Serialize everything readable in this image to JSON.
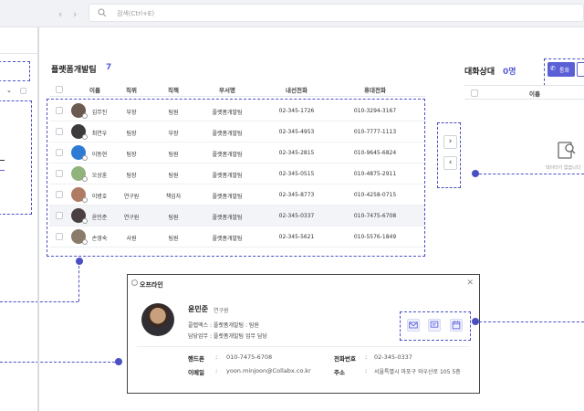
{
  "search": {
    "placeholder": "검색(Ctrl+E)"
  },
  "team": {
    "title": "플랫폼개발팀",
    "count": "7",
    "columns": [
      "이름",
      "직위",
      "직책",
      "부서명",
      "내선전화",
      "휴대전화"
    ],
    "rows": [
      {
        "name": "김무진",
        "rank": "부장",
        "role": "팀원",
        "dept": "플랫폼개발팀",
        "ext": "02-345-1726",
        "mobile": "010-3294-3167",
        "color": "#6b5a4f"
      },
      {
        "name": "최연우",
        "rank": "팀장",
        "role": "부장",
        "dept": "플랫폼개발팀",
        "ext": "02-345-4953",
        "mobile": "010-7777-1113",
        "color": "#3d3a3c"
      },
      {
        "name": "이동현",
        "rank": "팀장",
        "role": "팀원",
        "dept": "플랫폼개발팀",
        "ext": "02-345-2815",
        "mobile": "010-9645-6824",
        "color": "#2e7bd6"
      },
      {
        "name": "오상훈",
        "rank": "팀장",
        "role": "팀원",
        "dept": "플랫폼개발팀",
        "ext": "02-345-0515",
        "mobile": "010-4875-2911",
        "color": "#8fb37a"
      },
      {
        "name": "이병호",
        "rank": "연구원",
        "role": "책임자",
        "dept": "플랫폼개발팀",
        "ext": "02-345-8773",
        "mobile": "010-4258-0715",
        "color": "#b07a63"
      },
      {
        "name": "윤민준",
        "rank": "연구원",
        "role": "팀원",
        "dept": "플랫폼개발팀",
        "ext": "02-345-0337",
        "mobile": "010-7475-6708",
        "color": "#4a4043"
      },
      {
        "name": "손영숙",
        "rank": "사원",
        "role": "팀원",
        "dept": "플랫폼개발팀",
        "ext": "02-345-5621",
        "mobile": "010-5576-1849",
        "color": "#8a7b6a"
      }
    ]
  },
  "chat_status": {
    "title": "대화상대",
    "count": "0명",
    "call_label": "통화",
    "column_name": "이름",
    "empty_text": "데이터가 없습니다"
  },
  "profile_card": {
    "status": "오프라인",
    "name": "윤민준",
    "rank": "연구원",
    "line1": "콜랩엑스 : 플랫폼개발팀 : 팀원",
    "line2": "담당업무 : 플랫폼개발팀 업무 담당",
    "phone_label": "핸드폰",
    "phone_value": "010-7475-6708",
    "tel_label": "전화번호",
    "tel_value": "02-345-0337",
    "email_label": "이메일",
    "email_value": "yoon.minjoon@Collabx.co.kr",
    "address_label": "주소",
    "address_value": "서울특별시 마포구 와우산로 105 5층"
  }
}
